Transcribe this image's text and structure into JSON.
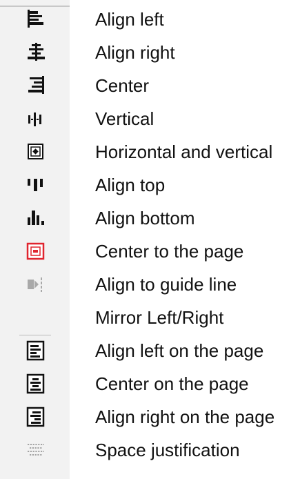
{
  "items": [
    {
      "label": "Align left",
      "icon": "align-left-icon"
    },
    {
      "label": "Align right",
      "icon": "align-center-bars-icon"
    },
    {
      "label": "Center",
      "icon": "align-right-icon"
    },
    {
      "label": "Vertical",
      "icon": "distribute-vertical-icon"
    },
    {
      "label": "Horizontal and vertical",
      "icon": "center-box-icon"
    },
    {
      "label": "Align top",
      "icon": "align-top-icon"
    },
    {
      "label": "Align bottom",
      "icon": "align-bottom-icon"
    },
    {
      "label": "Center to the page",
      "icon": "center-page-icon"
    },
    {
      "label": "Align to guide line",
      "icon": "guide-line-icon"
    },
    {
      "label": "Mirror Left/Right",
      "icon": "mirror-icon"
    },
    {
      "label": "Align left on the page",
      "icon": "page-align-left-icon"
    },
    {
      "label": "Center on the page",
      "icon": "page-center-icon"
    },
    {
      "label": "Align right on the page",
      "icon": "page-align-right-icon"
    },
    {
      "label": "Space justification",
      "icon": "space-justify-icon"
    }
  ],
  "colors": {
    "icon": "#111111",
    "accent": "#e0252f",
    "disabled": "#a9a9a9"
  }
}
